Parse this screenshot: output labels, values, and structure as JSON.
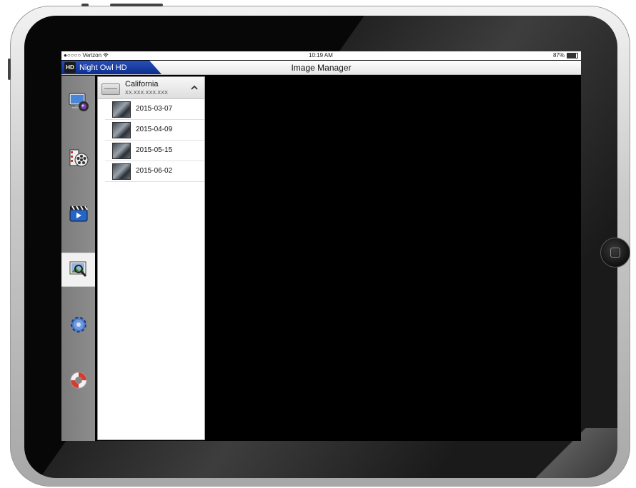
{
  "status_bar": {
    "carrier": "●○○○○ Verizon",
    "wifi": "wifi-icon",
    "time": "10:19 AM",
    "battery": "87%",
    "battery_level": 87
  },
  "navbar": {
    "brand_logo": "HD",
    "brand": "Night Owl HD",
    "title": "Image Manager"
  },
  "sidebar": {
    "items": [
      {
        "icon": "live-view-monitor-icon",
        "active": false
      },
      {
        "icon": "playback-film-reel-icon",
        "active": false
      },
      {
        "icon": "video-clapperboard-icon",
        "active": false
      },
      {
        "icon": "image-manager-magnifier-icon",
        "active": true
      },
      {
        "icon": "settings-gear-icon",
        "active": false
      },
      {
        "icon": "support-lifebuoy-icon",
        "active": false
      }
    ]
  },
  "device_group": {
    "name": "California",
    "ip": "XX.XXX.XXX.XXX",
    "expanded": true,
    "dates": [
      "2015-03-07",
      "2015-04-09",
      "2015-05-15",
      "2015-06-02"
    ]
  },
  "colors": {
    "brand_blue": "#0b2d8f",
    "sidebar_gray": "#858585",
    "screen_black": "#000000"
  }
}
